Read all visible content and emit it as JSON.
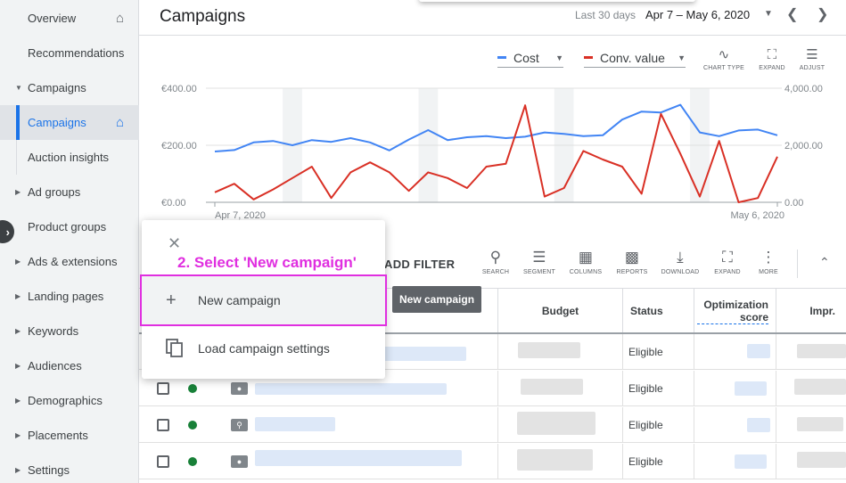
{
  "header": {
    "title": "Campaigns",
    "date_range_label": "Last 30 days",
    "date_range": "Apr 7 – May 6, 2020"
  },
  "sidebar": {
    "items": [
      {
        "label": "Overview",
        "home": true
      },
      {
        "label": "Recommendations"
      },
      {
        "label": "Campaigns",
        "expanded": true
      },
      {
        "label": "Campaigns",
        "active": true,
        "home": true
      },
      {
        "label": "Auction insights",
        "sub": true
      },
      {
        "label": "Ad groups"
      },
      {
        "label": "Product groups"
      },
      {
        "label": "Ads & extensions"
      },
      {
        "label": "Landing pages"
      },
      {
        "label": "Keywords"
      },
      {
        "label": "Audiences"
      },
      {
        "label": "Demographics"
      },
      {
        "label": "Placements"
      },
      {
        "label": "Settings"
      }
    ]
  },
  "chart_controls": {
    "metric1": "Cost",
    "metric2": "Conv. value",
    "tools": [
      "CHART TYPE",
      "EXPAND",
      "ADJUST"
    ]
  },
  "chart_data": {
    "type": "line",
    "x_start_label": "Apr 7, 2020",
    "x_end_label": "May 6, 2020",
    "left_ticks": [
      "€400.00",
      "€200.00",
      "€0.00"
    ],
    "right_ticks": [
      "4,000.00",
      "2,000.00",
      "0.00"
    ],
    "ylim_left": [
      0,
      400
    ],
    "ylim_right": [
      0,
      4000
    ],
    "series": [
      {
        "name": "Cost",
        "color": "#4285f4",
        "axis": "left",
        "values": [
          178,
          183,
          210,
          215,
          200,
          218,
          212,
          225,
          210,
          182,
          220,
          253,
          218,
          228,
          232,
          225,
          230,
          245,
          240,
          232,
          235,
          290,
          318,
          315,
          342,
          245,
          232,
          252,
          255,
          235
        ]
      },
      {
        "name": "Conv. value",
        "color": "#d93025",
        "axis": "right",
        "values": [
          350,
          650,
          100,
          450,
          850,
          1250,
          150,
          1050,
          1400,
          1050,
          400,
          1050,
          850,
          500,
          1250,
          1350,
          3400,
          200,
          500,
          1800,
          1500,
          1250,
          300,
          3100,
          1700,
          200,
          2150,
          0,
          150,
          1600
        ]
      }
    ],
    "shaded_bands": [
      4,
      11,
      18,
      25
    ]
  },
  "toolbar": {
    "add_filter": "ADD FILTER",
    "tools": [
      "SEARCH",
      "SEGMENT",
      "COLUMNS",
      "REPORTS",
      "DOWNLOAD",
      "EXPAND",
      "MORE"
    ]
  },
  "table": {
    "columns": {
      "budget": "Budget",
      "status": "Status",
      "optimization_score": "Optimization score",
      "impr": "Impr."
    },
    "rows": [
      {
        "status": "Eligible"
      },
      {
        "status": "Eligible"
      },
      {
        "status": "Eligible"
      },
      {
        "status": "Eligible"
      }
    ]
  },
  "menu": {
    "annotation": "2. Select 'New campaign'",
    "new_campaign": "New campaign",
    "load_settings": "Load campaign settings",
    "tooltip": "New campaign"
  }
}
